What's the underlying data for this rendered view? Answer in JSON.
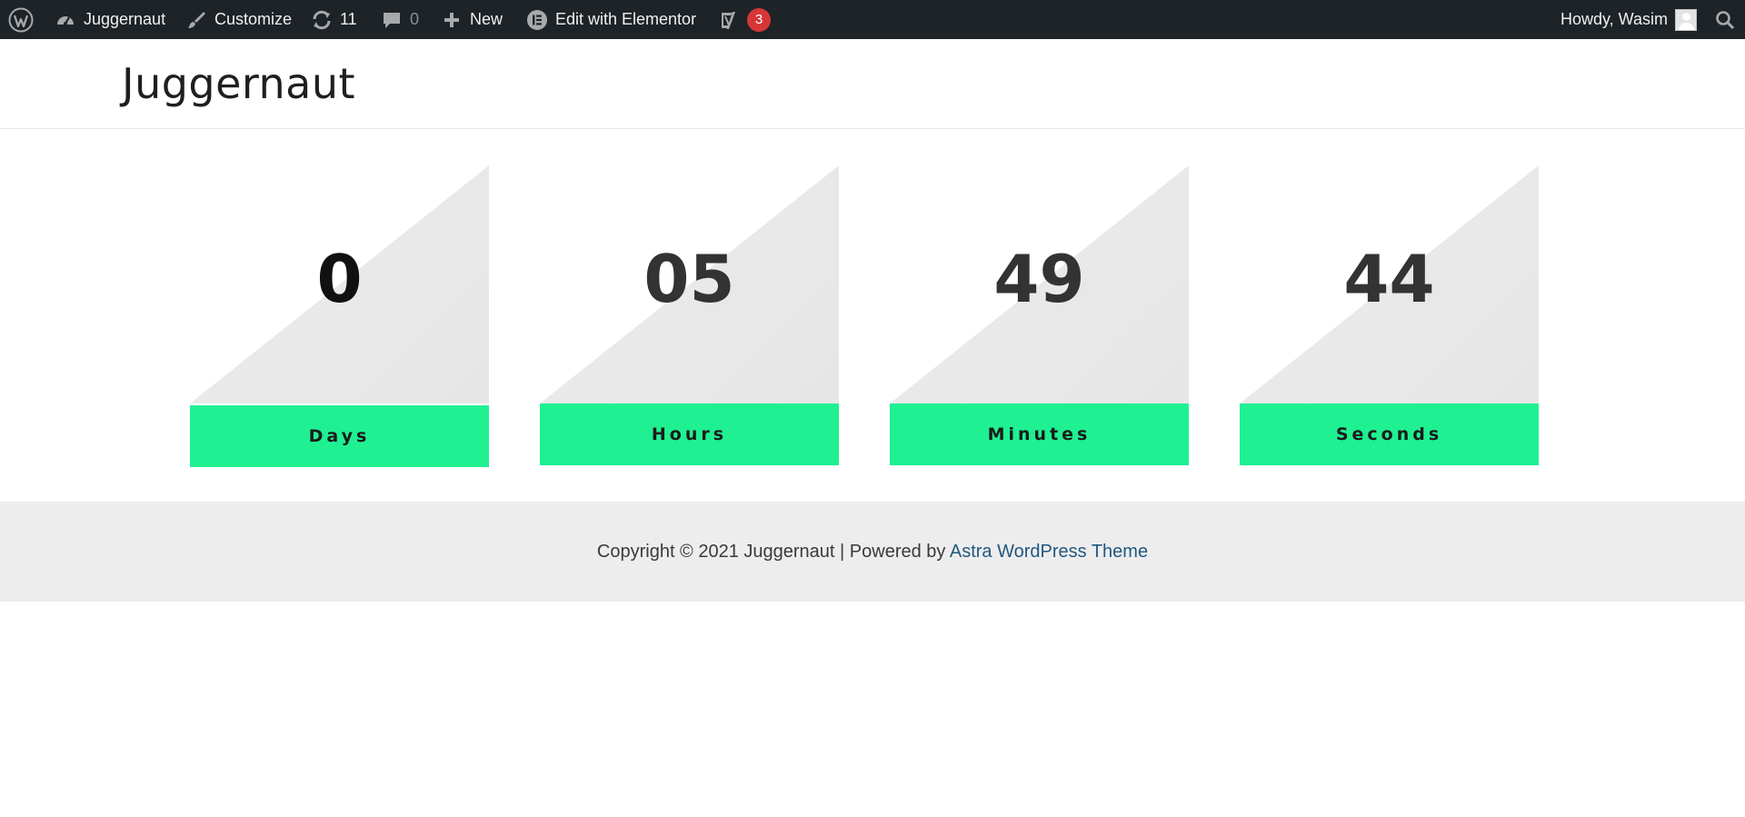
{
  "admin_bar": {
    "site_name": "Juggernaut",
    "customize": "Customize",
    "updates_count": "11",
    "comments_count": "0",
    "new": "New",
    "edit_elementor": "Edit with Elementor",
    "yoast_badge": "3",
    "howdy": "Howdy, Wasim",
    "icons": {
      "wordpress": "wordpress-logo-icon",
      "dashboard": "dashboard-icon",
      "customize": "brush-icon",
      "updates": "refresh-icon",
      "comments": "comment-icon",
      "new": "plus-icon",
      "elementor": "elementor-icon",
      "yoast": "yoast-icon",
      "search": "search-icon"
    },
    "colors": {
      "background": "#1d2327",
      "badge": "#d63638"
    }
  },
  "header": {
    "site_title": "Juggernaut"
  },
  "countdown": {
    "units": [
      {
        "value": "0",
        "label": "Days"
      },
      {
        "value": "05",
        "label": "Hours"
      },
      {
        "value": "49",
        "label": "Minutes"
      },
      {
        "value": "44",
        "label": "Seconds"
      }
    ],
    "colors": {
      "label_background": "#1ff092",
      "triangle": "#e8e8e8"
    }
  },
  "footer": {
    "copyright_text": "Copyright © 2021 Juggernaut | Powered by ",
    "theme_link": "Astra WordPress Theme"
  }
}
